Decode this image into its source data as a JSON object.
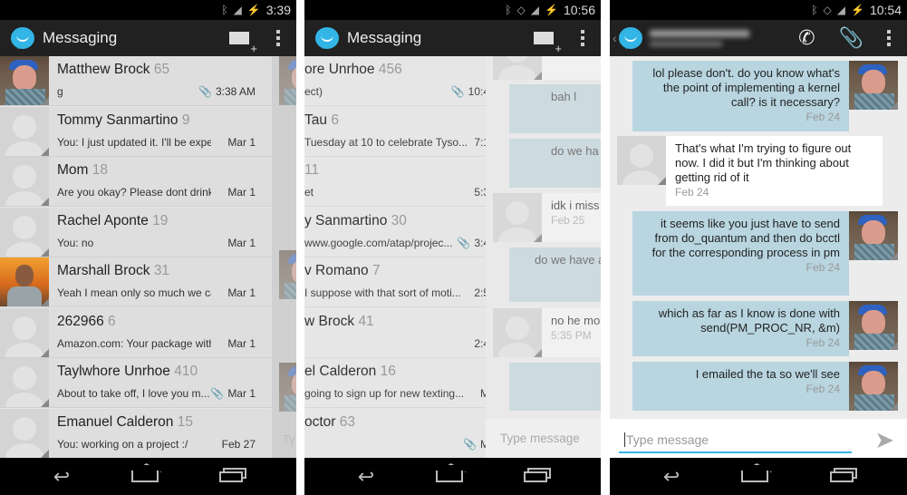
{
  "colors": {
    "accent": "#33b5e5",
    "outgoing_bubble": "#b8d5e0",
    "incoming_bubble": "#ffffff",
    "action_bar": "#212121"
  },
  "screen1": {
    "status_time": "3:39",
    "title": "Messaging",
    "conversations": [
      {
        "name": "Matthew Brock",
        "count": "65",
        "preview": "g",
        "time": "3:38 AM",
        "attachment": true,
        "avatar": "photo-cap"
      },
      {
        "name": "Tommy Sanmartino",
        "count": "9",
        "preview": "You: I just updated it. I'll be expe...",
        "time": "Mar 1",
        "attachment": false,
        "avatar": "default"
      },
      {
        "name": "Mom",
        "count": "18",
        "preview": "Are you okay? Please dont drink...",
        "time": "Mar 1",
        "attachment": false,
        "avatar": "default"
      },
      {
        "name": "Rachel Aponte",
        "count": "19",
        "preview": "You: no",
        "time": "Mar 1",
        "attachment": false,
        "avatar": "default"
      },
      {
        "name": "Marshall Brock",
        "count": "31",
        "preview": "Yeah I mean only so much we ca...",
        "time": "Mar 1",
        "attachment": false,
        "avatar": "photo-sunset"
      },
      {
        "name": "262966",
        "count": "6",
        "preview": "Amazon.com: Your package with...",
        "time": "Mar 1",
        "attachment": false,
        "avatar": "default"
      },
      {
        "name": "Taylwhore Unrhoe",
        "count": "410",
        "preview": "About to take off, I love you m...",
        "time": "Mar 1",
        "attachment": true,
        "avatar": "default"
      },
      {
        "name": "Emanuel Calderon",
        "count": "15",
        "preview": "You: working on a project :/",
        "time": "Feb 27",
        "attachment": false,
        "avatar": "default"
      }
    ],
    "peek_input_placeholder": "Ty"
  },
  "screen2": {
    "status_time": "10:56",
    "title": "Messaging",
    "conversations": [
      {
        "name": "ore Unrhoe",
        "count": "456",
        "preview": "ect)",
        "time": "10:4",
        "attachment": true
      },
      {
        "name": "Tau",
        "count": "6",
        "preview": "Tuesday at 10 to celebrate Tyso...",
        "time": "7:1",
        "attachment": false
      },
      {
        "name": "",
        "count": "11",
        "preview": "et",
        "time": "5:3",
        "attachment": false
      },
      {
        "name": "y Sanmartino",
        "count": "30",
        "preview": "www.google.com/atap/projec...",
        "time": "3:4",
        "attachment": true
      },
      {
        "name": "v Romano",
        "count": "7",
        "preview": "I suppose with that sort of moti...",
        "time": "2:5",
        "attachment": false
      },
      {
        "name": "w Brock",
        "count": "41",
        "preview": "",
        "time": "2:4",
        "attachment": false
      },
      {
        "name": "el Calderon",
        "count": "16",
        "preview": "going to sign up for new texting...",
        "time": "M",
        "attachment": false
      },
      {
        "name": "octor",
        "count": "63",
        "preview": "",
        "time": "M",
        "attachment": true
      }
    ],
    "messages": [
      {
        "dir": "in",
        "text": "",
        "date": "Feb 24"
      },
      {
        "dir": "out",
        "text": "bah l",
        "date": ""
      },
      {
        "dir": "out",
        "text": "do we ha",
        "date": ""
      },
      {
        "dir": "in",
        "text": "idk i miss",
        "date": "Feb 25"
      },
      {
        "dir": "out",
        "text": "do we have a",
        "date": ""
      },
      {
        "dir": "in",
        "text": "no he mo",
        "date": "5:35 PM"
      },
      {
        "dir": "out",
        "text": "",
        "date": ""
      }
    ],
    "input_placeholder": "Type message"
  },
  "screen3": {
    "status_time": "10:54",
    "messages": [
      {
        "dir": "out",
        "text": "lol please don't. do you know what's the point of implementing a kernel call? is it necessary?",
        "date": "Feb 24"
      },
      {
        "dir": "in",
        "text": "That's what I'm trying to figure out now. I did it but I'm thinking about getting rid of it",
        "date": "Feb 24"
      },
      {
        "dir": "out",
        "text": "it seems like you just have to send from do_quantum and then do bcctl for the corresponding process in pm",
        "date": "Feb 24"
      },
      {
        "dir": "out",
        "text": "which as far as I know is done with send(PM_PROC_NR, &m)",
        "date": "Feb 24"
      },
      {
        "dir": "out",
        "text": "I emailed the ta so we'll see",
        "date": "Feb 24"
      }
    ],
    "input_placeholder": "Type message"
  }
}
